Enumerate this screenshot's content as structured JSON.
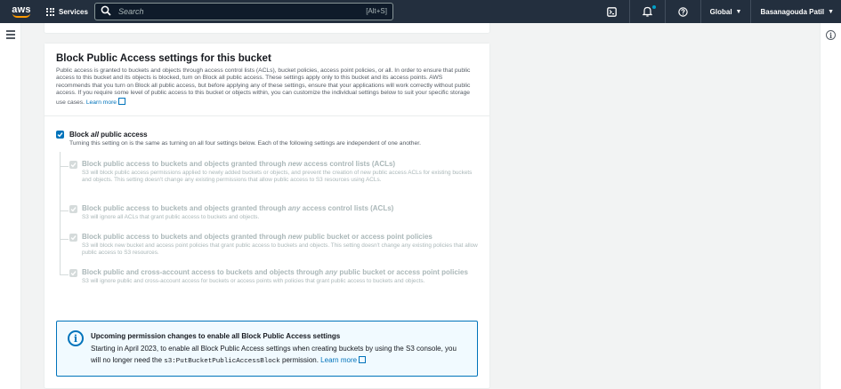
{
  "nav": {
    "logo": "aws",
    "services": "Services",
    "search_placeholder": "Search",
    "search_shortcut": "[Alt+S]",
    "region": "Global",
    "user": "Basanagouda Patil"
  },
  "section": {
    "title": "Block Public Access settings for this bucket",
    "description": "Public access is granted to buckets and objects through access control lists (ACLs), bucket policies, access point policies, or all. In order to ensure that public access to this bucket and its objects is blocked, turn on Block all public access. These settings apply only to this bucket and its access points. AWS recommends that you turn on Block all public access, but before applying any of these settings, ensure that your applications will work correctly without public access. If you require some level of public access to this bucket or objects within, you can customize the individual settings below to suit your specific storage use cases.",
    "learn_more": "Learn more"
  },
  "master": {
    "label_pre": "Block ",
    "label_em": "all",
    "label_post": " public access",
    "description": "Turning this setting on is the same as turning on all four settings below. Each of the following settings are independent of one another.",
    "checked": true
  },
  "settings": [
    {
      "label_pre": "Block public access to buckets and objects granted through ",
      "label_em": "new",
      "label_post": " access control lists (ACLs)",
      "description": "S3 will block public access permissions applied to newly added buckets or objects, and prevent the creation of new public access ACLs for existing buckets and objects. This setting doesn't change any existing permissions that allow public access to S3 resources using ACLs."
    },
    {
      "label_pre": "Block public access to buckets and objects granted through ",
      "label_em": "any",
      "label_post": " access control lists (ACLs)",
      "description": "S3 will ignore all ACLs that grant public access to buckets and objects."
    },
    {
      "label_pre": "Block public access to buckets and objects granted through ",
      "label_em": "new",
      "label_post": " public bucket or access point policies",
      "description": "S3 will block new bucket and access point policies that grant public access to buckets and objects. This setting doesn't change any existing policies that allow public access to S3 resources."
    },
    {
      "label_pre": "Block public and cross-account access to buckets and objects through ",
      "label_em": "any",
      "label_post": " public bucket or access point policies",
      "description": "S3 will ignore public and cross-account access for buckets or access points with policies that grant public access to buckets and objects."
    }
  ],
  "alert": {
    "title": "Upcoming permission changes to enable all Block Public Access settings",
    "body_pre": "Starting in April 2023, to enable all Block Public Access settings when creating buckets by using the S3 console, you will no longer need the ",
    "body_code": "s3:PutBucketPublicAccessBlock",
    "body_post": " permission.",
    "learn_more": "Learn more"
  },
  "colors": {
    "nav_bg": "#232f3e",
    "accent": "#0073bb",
    "aws_orange": "#ff9900",
    "disabled": "#aab7b8"
  }
}
